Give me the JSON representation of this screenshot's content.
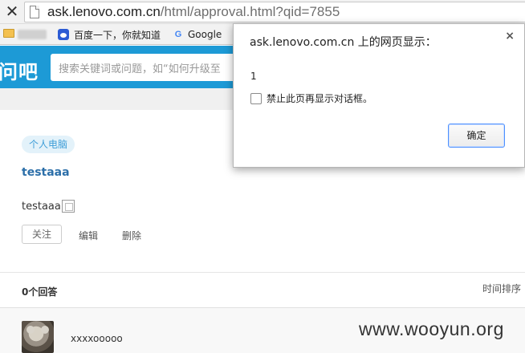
{
  "browser": {
    "url_host": "ask.lenovo.com.cn",
    "url_path": "/html/approval.html?qid=7855",
    "bookmarks": [
      {
        "label": "百度一下，你就知道",
        "icon": "baidu-paw-icon"
      },
      {
        "label": "Google",
        "icon": "google-g-icon"
      }
    ]
  },
  "header": {
    "logo": "问吧",
    "search_placeholder": "搜索关键词或问题，如“如何升级至"
  },
  "question": {
    "tag": "个人电脑",
    "title": "testaaa",
    "body": "testaaa",
    "actions": {
      "follow": "关注",
      "edit": "编辑",
      "delete": "删除"
    }
  },
  "answers": {
    "count_label": "0个回答",
    "sort_label": "时间排序",
    "user": "xxxxooooo"
  },
  "watermark": "www.wooyun.org",
  "dialog": {
    "title": "ask.lenovo.com.cn 上的网页显示：",
    "message": "1",
    "checkbox_label": "禁止此页再显示对话框。",
    "ok_label": "确定",
    "close_glyph": "×"
  },
  "colors": {
    "header_blue": "#1d9ad6",
    "tag_text": "#3f9ed8",
    "title_link": "#2c6fa9"
  }
}
